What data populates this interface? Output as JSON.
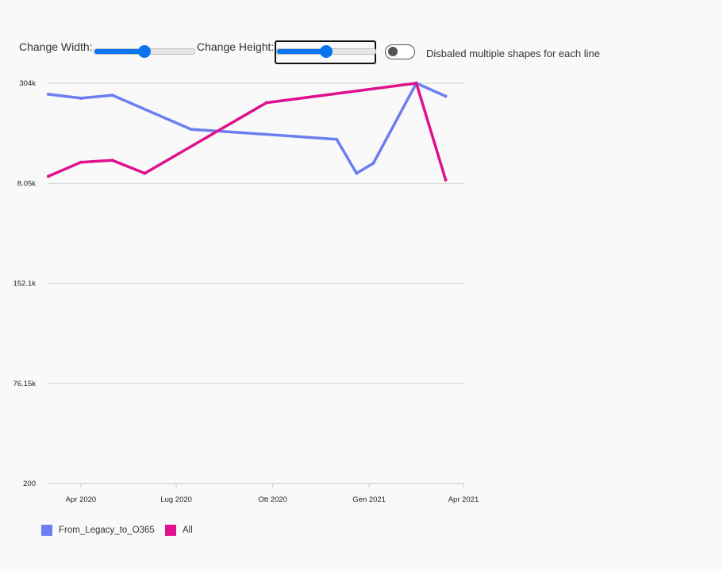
{
  "controls": {
    "width_label": "Change Width:",
    "width_value": 0.5,
    "height_label": "Change Height:",
    "height_value": 0.5,
    "toggle_label": "Disbaled multiple shapes for each line",
    "toggle_on": false
  },
  "colors": {
    "series_blue": "#6b7ff0",
    "series_magenta": "#e0108e",
    "grid": "#d4d4d4",
    "slider_accent": "#0a74f0"
  },
  "chart_data": {
    "type": "line",
    "y_ticks": [
      "304k",
      "8.05k",
      "152.1k",
      "76.15k",
      "200"
    ],
    "x_ticks": [
      "Apr 2020",
      "Lug 2020",
      "Ott 2020",
      "Gen 2021",
      "Apr 2021"
    ],
    "x_tick_dates": [
      "2020-04-01",
      "2020-07-01",
      "2020-10-01",
      "2021-01-01",
      "2021-04-01"
    ],
    "xlim": [
      "2020-03-01",
      "2021-04-01"
    ],
    "grid": "horizontal",
    "legend_position": "bottom-left",
    "series": [
      {
        "name": "From_Legacy_to_O365",
        "color": "#6b7ff0",
        "points": [
          {
            "x": "2020-03-01",
            "y": 8900
          },
          {
            "x": "2020-04-01",
            "y": 8500
          },
          {
            "x": "2020-05-01",
            "y": 8800
          },
          {
            "x": "2020-07-15",
            "y": 5400
          },
          {
            "x": "2020-12-01",
            "y": 4400
          },
          {
            "x": "2020-12-20",
            "y": 1000
          },
          {
            "x": "2021-01-05",
            "y": 2000
          },
          {
            "x": "2021-02-15",
            "y": 304000
          },
          {
            "x": "2021-03-15",
            "y": 8700
          }
        ]
      },
      {
        "name": "All",
        "color": "#e0108e",
        "points": [
          {
            "x": "2020-03-01",
            "y": 700
          },
          {
            "x": "2020-04-01",
            "y": 2100
          },
          {
            "x": "2020-05-01",
            "y": 2300
          },
          {
            "x": "2020-06-01",
            "y": 1000
          },
          {
            "x": "2020-09-25",
            "y": 8050
          },
          {
            "x": "2021-02-15",
            "y": 304000
          },
          {
            "x": "2021-03-15",
            "y": 350
          }
        ]
      }
    ]
  }
}
